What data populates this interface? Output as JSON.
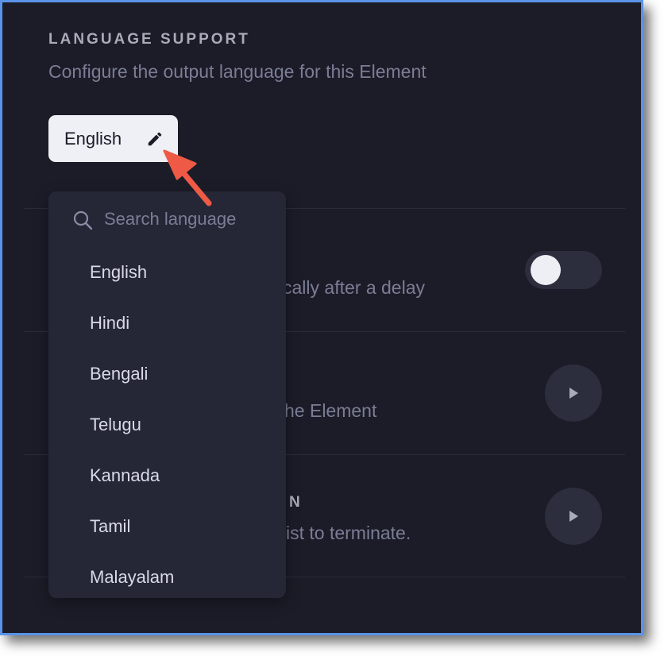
{
  "section": {
    "title": "LANGUAGE SUPPORT",
    "subtitle": "Configure the output language for this Element"
  },
  "language_chip": {
    "label": "English",
    "icon": "pencil-icon"
  },
  "dropdown": {
    "search_placeholder": "Search language",
    "search_icon": "search-icon",
    "items": [
      {
        "label": "English"
      },
      {
        "label": "Hindi"
      },
      {
        "label": "Bengali"
      },
      {
        "label": "Telugu"
      },
      {
        "label": "Kannada"
      },
      {
        "label": "Tamil"
      },
      {
        "label": "Malayalam"
      }
    ]
  },
  "rows": [
    {
      "visible_text": "cally after a delay",
      "control": "toggle",
      "toggle_on": false
    },
    {
      "visible_text": "he Element",
      "control": "play-button",
      "icon": "play-icon"
    },
    {
      "visible_title": "N",
      "visible_text": "ist to terminate.",
      "control": "play-button",
      "icon": "play-icon"
    }
  ],
  "annotation": {
    "icon": "arrow-annotation",
    "color": "#ee5a45"
  },
  "colors": {
    "background": "#1b1c27",
    "panel": "#252737",
    "chip": "#efeff6",
    "muted_text": "#7b7d96",
    "frame_border": "#5a93e8"
  }
}
